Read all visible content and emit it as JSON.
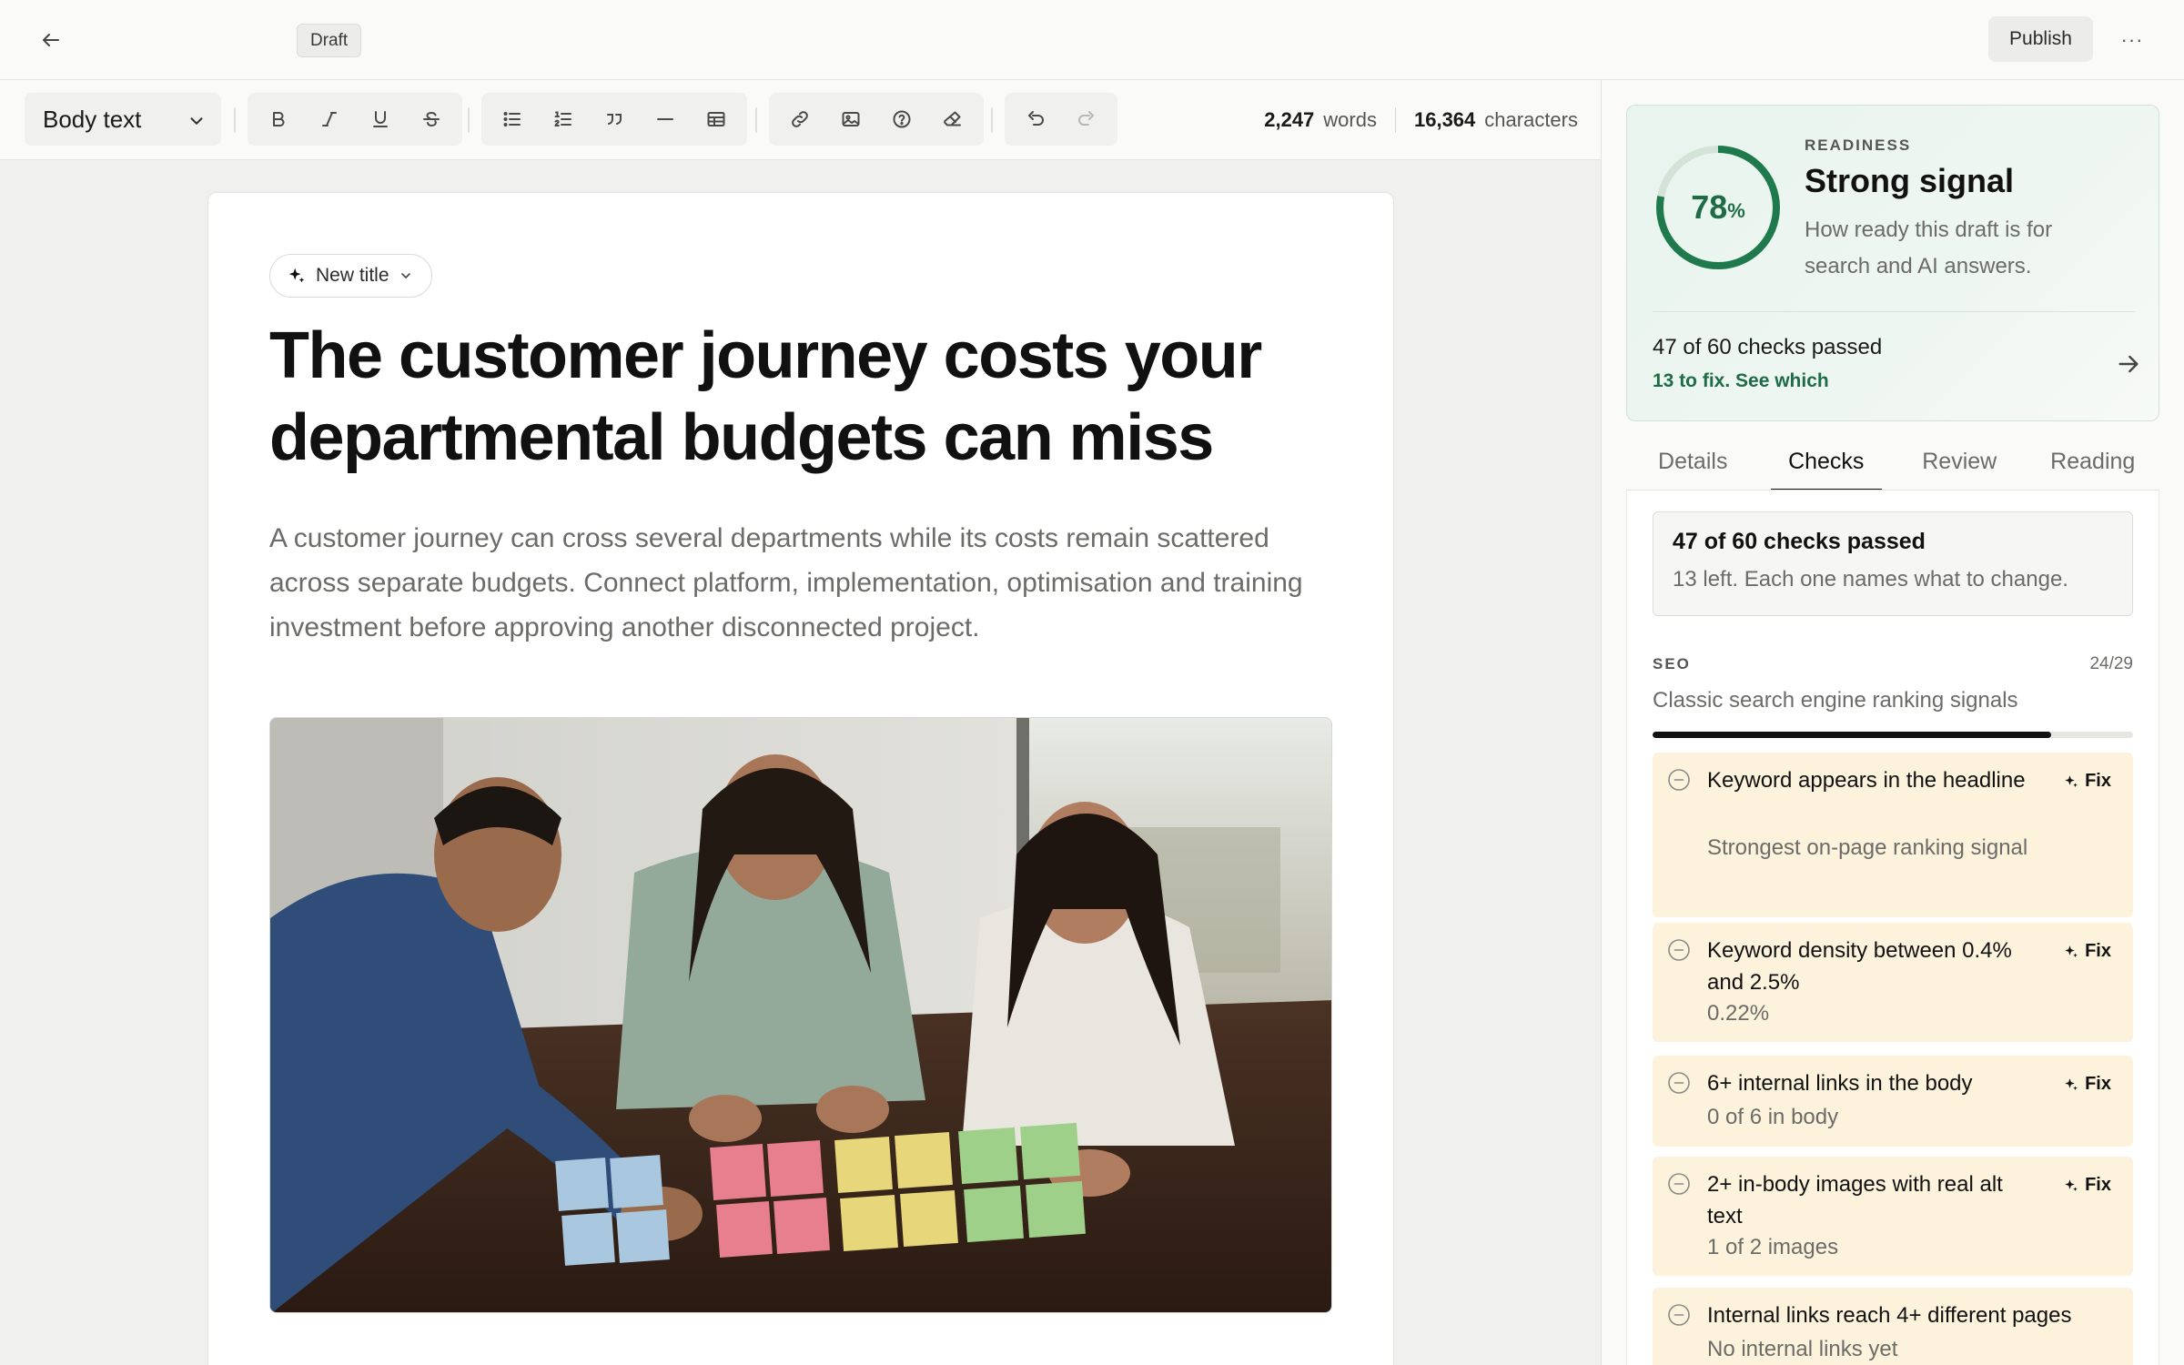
{
  "topbar": {
    "draft_label": "Draft",
    "publish_label": "Publish",
    "more_label": "···"
  },
  "toolbar": {
    "style_select": "Body text",
    "words_count": "2,247",
    "words_label": "words",
    "chars_count": "16,364",
    "chars_label": "characters"
  },
  "document": {
    "new_title_label": "New title",
    "title": "The customer journey costs your departmental budgets can miss",
    "lede": "A customer journey can cross several departments while its costs remain scattered across separate budgets. Connect platform, implementation, optimisation and training investment before approving another disconnected project."
  },
  "readiness": {
    "score": 78,
    "score_suffix": "%",
    "eyebrow": "READINESS",
    "title": "Strong signal",
    "description": "How ready this draft is for search and AI answers.",
    "checks_passed": "47 of 60 checks passed",
    "fix_link": "13 to fix. See which",
    "accent_color": "#1e7a4c"
  },
  "tabs": [
    {
      "label": "Details",
      "active": false
    },
    {
      "label": "Checks",
      "active": true
    },
    {
      "label": "Review",
      "active": false
    },
    {
      "label": "Reading",
      "active": false
    }
  ],
  "checks": {
    "summary_title": "47 of 60 checks passed",
    "summary_sub": "13 left. Each one names what to change.",
    "section": {
      "eyebrow": "SEO",
      "count": "24/29",
      "description": "Classic search engine ranking signals",
      "progress": 0.83
    },
    "fix_label": "Fix",
    "items": [
      {
        "title": "Keyword appears in the headline",
        "sub": "Strongest on-page ranking signal"
      },
      {
        "title": "Keyword density between 0.4% and 2.5%",
        "sub": "0.22%"
      },
      {
        "title": "6+ internal links in the body",
        "sub": "0 of 6 in body"
      },
      {
        "title": "2+ in-body images with real alt text",
        "sub": "1 of 2 images"
      },
      {
        "title": "Internal links reach 4+ different pages",
        "sub": "No internal links yet"
      }
    ]
  }
}
